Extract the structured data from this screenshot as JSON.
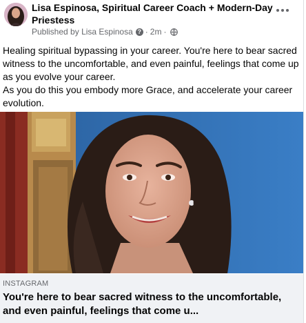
{
  "post": {
    "author": "Lisa Espinosa, Spiritual Career Coach + Modern-Day Priestess",
    "published_prefix": "Published by",
    "published_by": "Lisa Espinosa",
    "time": "2m",
    "text_lines": [
      "Healing spiritual bypassing in your career. You're here to bear sacred witness to the uncomfortable, and even painful, feelings that come up as you evolve your career.",
      "As you do this you embody more Grace, and accelerate your career evolution."
    ],
    "link": {
      "source": "INSTAGRAM",
      "title": "You're here to bear sacred witness to the uncomfortable, and even painful, feelings that come u..."
    }
  },
  "icons": {
    "more": "more-options-icon",
    "help": "question-icon",
    "audience": "globe-icon"
  },
  "colors": {
    "secondary_text": "#65676b",
    "footer_bg": "#f0f2f5",
    "wall_blue": "#2f6fb3"
  }
}
